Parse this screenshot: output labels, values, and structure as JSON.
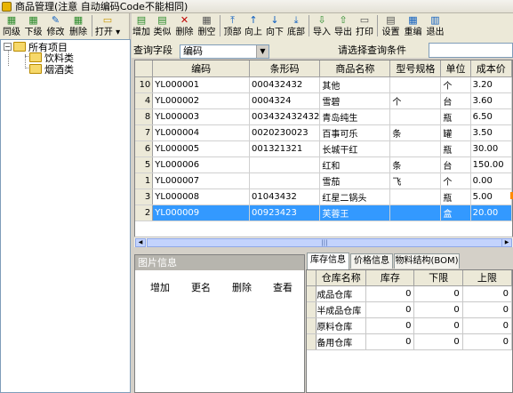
{
  "window": {
    "title": "商品管理(注意 自动编码Code不能相同)"
  },
  "toolbar_left": [
    {
      "label": "同级",
      "icon": "same-level-icon"
    },
    {
      "label": "下级",
      "icon": "sub-level-icon"
    },
    {
      "label": "修改",
      "icon": "edit-icon"
    },
    {
      "label": "删除",
      "icon": "delete-icon"
    },
    {
      "label": "打开",
      "icon": "open-folder-icon"
    }
  ],
  "toolbar_right": [
    {
      "label": "增加",
      "icon": "add-icon"
    },
    {
      "label": "类似",
      "icon": "similar-icon"
    },
    {
      "label": "删除",
      "icon": "delete-icon"
    },
    {
      "label": "删空",
      "icon": "clear-icon"
    },
    {
      "label": "顶部",
      "icon": "top-icon"
    },
    {
      "label": "向上",
      "icon": "up-icon"
    },
    {
      "label": "向下",
      "icon": "down-icon"
    },
    {
      "label": "底部",
      "icon": "bottom-icon"
    },
    {
      "label": "导入",
      "icon": "import-icon"
    },
    {
      "label": "导出",
      "icon": "export-icon"
    },
    {
      "label": "打印",
      "icon": "print-icon"
    },
    {
      "label": "设置",
      "icon": "settings-icon"
    },
    {
      "label": "重编",
      "icon": "renumber-icon"
    },
    {
      "label": "退出",
      "icon": "exit-icon"
    }
  ],
  "tree": {
    "root": "所有项目",
    "children": [
      "饮料类",
      "烟酒类"
    ]
  },
  "query": {
    "field_label": "查询字段",
    "field_value": "编码",
    "condition_label": "请选择查询条件",
    "condition_value": ""
  },
  "grid": {
    "columns": [
      "编码",
      "条形码",
      "商品名称",
      "型号规格",
      "单位",
      "成本价"
    ],
    "rows": [
      {
        "num": "10",
        "code": "YL000001",
        "barcode": "000432432",
        "name": "其他",
        "spec": "",
        "unit": "个",
        "cost": "3.20"
      },
      {
        "num": "4",
        "code": "YL000002",
        "barcode": "0004324",
        "name": "雪碧",
        "spec": "个",
        "unit": "台",
        "cost": "3.60"
      },
      {
        "num": "8",
        "code": "YL000003",
        "barcode": "003432432432",
        "name": "青岛纯生",
        "spec": "",
        "unit": "瓶",
        "cost": "6.50"
      },
      {
        "num": "7",
        "code": "YL000004",
        "barcode": "0020230023",
        "name": "百事可乐",
        "spec": "条",
        "unit": "罐",
        "cost": "3.50"
      },
      {
        "num": "6",
        "code": "YL000005",
        "barcode": "001321321",
        "name": "长城干红",
        "spec": "",
        "unit": "瓶",
        "cost": "30.00"
      },
      {
        "num": "5",
        "code": "YL000006",
        "barcode": "",
        "name": "红和",
        "spec": "条",
        "unit": "台",
        "cost": "150.00"
      },
      {
        "num": "1",
        "code": "YL000007",
        "barcode": "",
        "name": "雪茄",
        "spec": "飞",
        "unit": "个",
        "cost": "0.00"
      },
      {
        "num": "3",
        "code": "YL000008",
        "barcode": "01043432",
        "name": "红星二锅头",
        "spec": "",
        "unit": "瓶",
        "cost": "5.00"
      },
      {
        "num": "2",
        "code": "YL000009",
        "barcode": "00923423",
        "name": "芙蓉王",
        "spec": "",
        "unit": "盒",
        "cost": "20.00"
      }
    ]
  },
  "image_panel": {
    "title": "图片信息",
    "actions": [
      "增加",
      "更名",
      "删除",
      "查看"
    ]
  },
  "tabs": [
    "库存信息",
    "价格信息",
    "物料结构(BOM)"
  ],
  "inventory": {
    "columns": [
      "仓库名称",
      "库存",
      "下限",
      "上限"
    ],
    "rows": [
      {
        "name": "成品仓库",
        "stock": "0",
        "min": "0",
        "max": "0"
      },
      {
        "name": "半成品仓库",
        "stock": "0",
        "min": "0",
        "max": "0"
      },
      {
        "name": "原料仓库",
        "stock": "0",
        "min": "0",
        "max": "0"
      },
      {
        "name": "备用仓库",
        "stock": "0",
        "min": "0",
        "max": "0"
      }
    ]
  },
  "colors": {
    "selection": "#3399ff",
    "accent": "#ff8a00"
  }
}
